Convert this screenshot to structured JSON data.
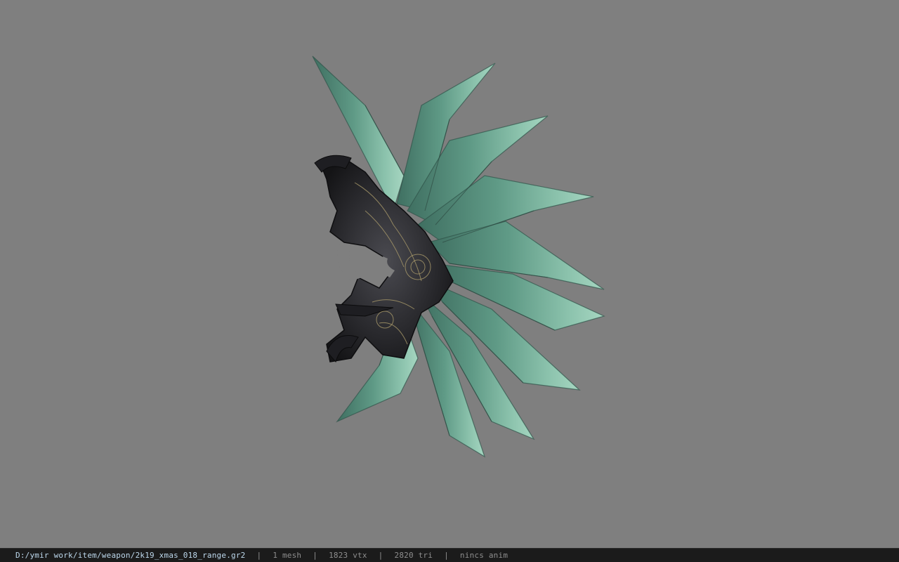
{
  "viewer": {
    "background_color": "#7f7f7f",
    "model": {
      "icon": "weapon-model-icon",
      "blade_color": "#6aa994",
      "frame_color": "#2d2d31",
      "ornament_color": "#a99a6a"
    }
  },
  "statusbar": {
    "file_path": "D:/ymir work/item/weapon/2k19_xmas_018_range.gr2",
    "separator": "|",
    "mesh_count": "1 mesh",
    "vertex_count": "1823 vtx",
    "triangle_count": "2820 tri",
    "anim_status": "nincs anim"
  }
}
